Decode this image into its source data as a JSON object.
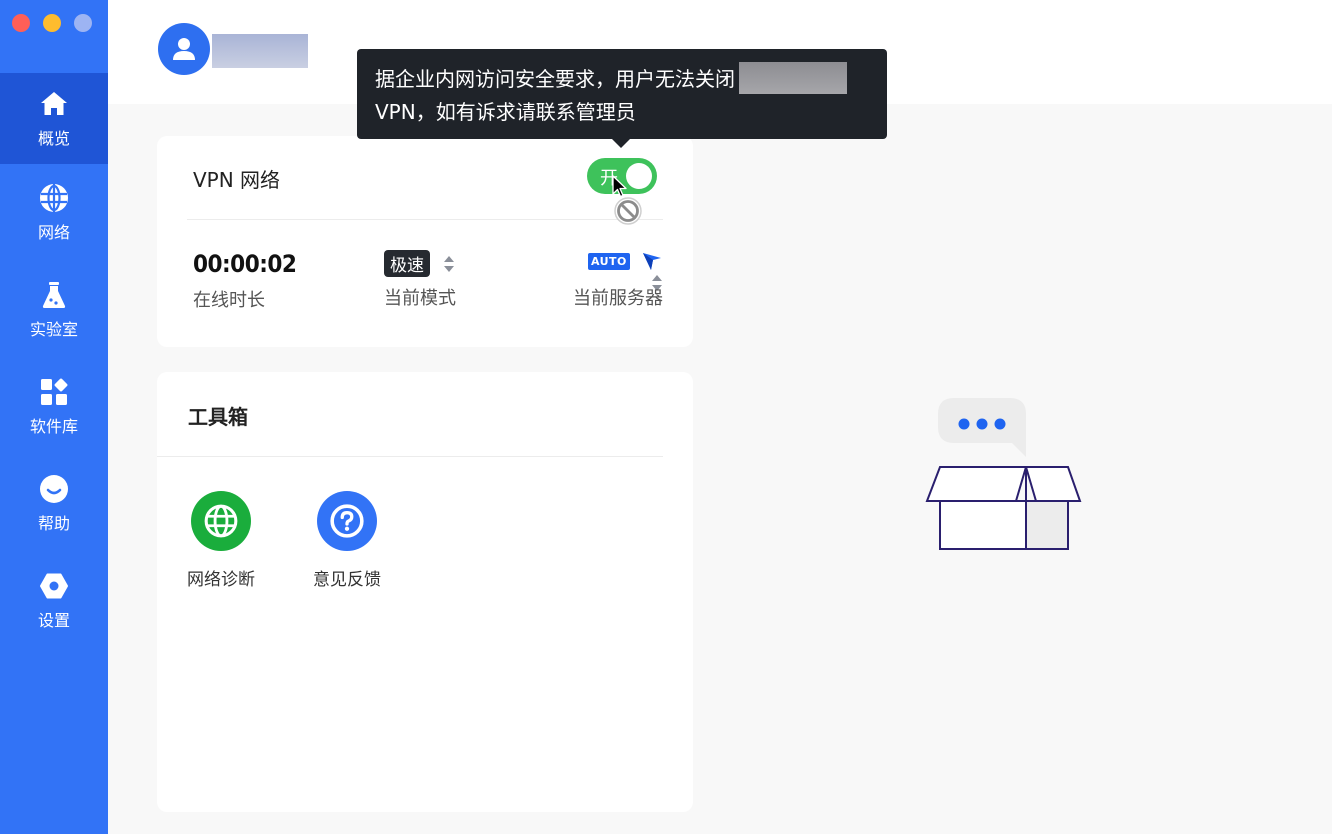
{
  "window": {
    "controls": [
      "close",
      "minimize",
      "zoom"
    ]
  },
  "sidebar": {
    "items": [
      {
        "label": "概览",
        "icon": "home-icon",
        "active": true
      },
      {
        "label": "网络",
        "icon": "globe-icon",
        "active": false
      },
      {
        "label": "实验室",
        "icon": "flask-icon",
        "active": false
      },
      {
        "label": "软件库",
        "icon": "apps-icon",
        "active": false
      },
      {
        "label": "帮助",
        "icon": "help-icon",
        "active": false
      },
      {
        "label": "设置",
        "icon": "settings-icon",
        "active": false
      }
    ]
  },
  "header": {
    "user_name": "████"
  },
  "tooltip": {
    "line1": "据企业内网访问安全要求，用户无法关闭",
    "line2": "VPN，如有诉求请联系管理员"
  },
  "vpn": {
    "title": "VPN 网络",
    "toggle_label": "开",
    "toggle_on": true,
    "online_time": "00:00:02",
    "online_time_label": "在线时长",
    "mode_value": "极速",
    "mode_label": "当前模式",
    "server_tag": "AUTO",
    "server_label": "当前服务器"
  },
  "toolbox": {
    "title": "工具箱",
    "tools": [
      {
        "label": "网络诊断",
        "icon": "globe-icon",
        "color": "#1aad3c"
      },
      {
        "label": "意见反馈",
        "icon": "question-icon",
        "color": "#3273f6"
      }
    ]
  },
  "colors": {
    "sidebar": "#3273f6",
    "sidebar_active": "#1f55d6",
    "toggle_on": "#3ec25b",
    "tooltip_bg": "#1f2329"
  }
}
